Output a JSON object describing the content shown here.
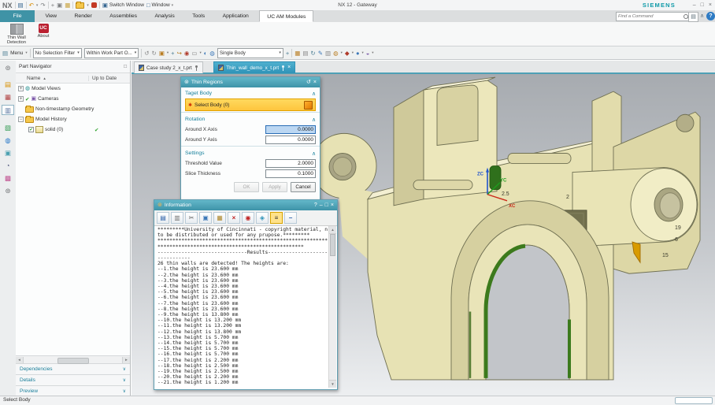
{
  "titlebar": {
    "logo": "NX",
    "title": "NX 12 - Gateway",
    "brand": "SIEMENS",
    "switch_window": "Switch Window",
    "window_menu": "Window"
  },
  "icons": {
    "caret": "▾",
    "minimize": "–",
    "maximize": "□",
    "close": "×",
    "help": "?",
    "collapse": "∧",
    "list": "▤",
    "menu": "▤",
    "chevron_up": "∧",
    "chevron_down": "∨",
    "sort": "▲",
    "reset": "↺",
    "star": "✱",
    "check": "✔",
    "plus": "+",
    "minus": "−",
    "left": "◄",
    "right": "►",
    "up": "▲",
    "down": "▼",
    "gear": "⊚",
    "float": "□",
    "camera": "▣",
    "model_views": "◍"
  },
  "quick_access": [
    "▤",
    "↶",
    "↷",
    "+",
    "▣",
    "▦"
  ],
  "ribbon_tabs": [
    "File",
    "View",
    "Render",
    "Assemblies",
    "Analysis",
    "Tools",
    "Application",
    "UC AM Modules"
  ],
  "find_command": {
    "placeholder": "Find a Command"
  },
  "ribbon_buttons": {
    "thin_wall": "Thin Wall Detection",
    "about": "About",
    "uc_text": "UC"
  },
  "toolbar": {
    "menu": "Menu",
    "selection_filter": "No Selection Filter",
    "scope": "Within Work Part O...",
    "body_type": "Single Body",
    "strip_a": [
      "↺",
      "↻",
      "▣",
      "+",
      "↪",
      "◉",
      "▭",
      "◐",
      "◍"
    ],
    "strip_b": [
      "▦",
      "▤",
      "↻",
      "✎",
      "▥",
      "◍"
    ],
    "strip_c": [
      "◆",
      "●",
      "◒"
    ]
  },
  "resource_bar": [
    "⊚",
    "▤",
    "▦",
    "▥",
    "▧",
    "◍",
    "▣",
    "◔",
    "▩",
    "⊛"
  ],
  "part_navigator": {
    "title": "Part Navigator",
    "col_name": "Name",
    "col_status": "Up to Date",
    "rows": [
      {
        "label": "Model Views"
      },
      {
        "label": "Cameras"
      },
      {
        "label": "Non-timestamp Geometry"
      },
      {
        "label": "Model History"
      },
      {
        "label": "solid (0)",
        "status": "✔"
      }
    ],
    "sections": [
      "Dependencies",
      "Details",
      "Preview"
    ]
  },
  "doc_tabs": [
    {
      "label": "Case study 2_x_t.prt"
    },
    {
      "label": "Thin_wall_demo_x_t.prt"
    }
  ],
  "dialog": {
    "title": "Thin Regions",
    "target_section": "Taget Body",
    "select_body": "Select Body (0)",
    "rotation_section": "Rotation",
    "around_x_label": "Around X Axis",
    "around_x_value": "0.0000",
    "around_y_label": "Around Y Axis",
    "around_y_value": "0.0000",
    "settings_section": "Settings",
    "threshold_label": "Threshold Value",
    "threshold_value": "2.0000",
    "slice_label": "Slice Thickness",
    "slice_value": "0.1000",
    "ok": "OK",
    "apply": "Apply",
    "cancel": "Cancel"
  },
  "info_window": {
    "title": "Information",
    "toolbar": [
      "▤",
      "▥",
      "✂",
      "▣",
      "▦",
      "×",
      "◉",
      "◈",
      "≡",
      "−"
    ],
    "content": "*********University of Cincinnati - copyright material, not\nto be distributed or used for any prupose.*********\n************************************************************\n*************************************************\n------------------------------Results------------------------\n-----------\n26 thin walls are detected! The heights are:\n--1.the height is 23.600 mm\n--2.the height is 23.600 mm\n--3.the height is 23.600 mm\n--4.the height is 23.600 mm\n--5.the height is 23.600 mm\n--6.the height is 23.600 mm\n--7.the height is 23.600 mm\n--8.the height is 23.600 mm\n--9.the height is 13.800 mm\n--10.the height is 13.200 mm\n--11.the height is 13.200 mm\n--12.the height is 13.800 mm\n--13.the height is 5.700 mm\n--14.the height is 5.700 mm\n--15.the height is 5.700 mm\n--16.the height is 5.700 mm\n--17.the height is 2.200 mm\n--18.the height is 2.500 mm\n--19.the height is 2.500 mm\n--20.the height is 2.200 mm\n--21.the height is 1.200 mm"
  },
  "viewport": {
    "axis_z": "ZC",
    "axis_y": "YC",
    "axis_x": "XC",
    "labels": [
      "2.5",
      "2",
      "19",
      "6",
      "15"
    ]
  },
  "status_bar": {
    "text": "Select Body"
  },
  "colors": {
    "accent": "#3f93a6",
    "active_tab": "#35a0c4",
    "select_row": "#ffd34d",
    "green_wall": "#3c7a1c",
    "body": "#e9e4b6",
    "uc_red": "#ba2030"
  }
}
